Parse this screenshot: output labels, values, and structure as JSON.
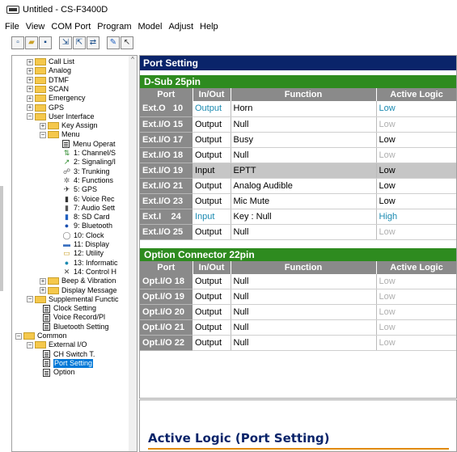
{
  "window": {
    "title": "Untitled - CS-F3400D"
  },
  "menu": [
    "File",
    "View",
    "COM Port",
    "Program",
    "Model",
    "Adjust",
    "Help"
  ],
  "toolbar": [
    "new-icon",
    "open-icon",
    "save-icon",
    "read-radio-icon",
    "write-radio-icon",
    "clone-icon",
    "pen-icon",
    "cursor-icon"
  ],
  "tree": {
    "items": [
      {
        "label": "Call List",
        "level": 1,
        "type": "folder",
        "toggle": "+"
      },
      {
        "label": "Analog",
        "level": 1,
        "type": "folder",
        "toggle": "+"
      },
      {
        "label": "DTMF",
        "level": 1,
        "type": "folder",
        "toggle": "+"
      },
      {
        "label": "SCAN",
        "level": 1,
        "type": "folder",
        "toggle": "+"
      },
      {
        "label": "Emergency",
        "level": 1,
        "type": "folder",
        "toggle": "+"
      },
      {
        "label": "GPS",
        "level": 1,
        "type": "folder",
        "toggle": "+"
      },
      {
        "label": "User Interface",
        "level": 1,
        "type": "folder",
        "toggle": "−"
      },
      {
        "label": "Key Assign",
        "level": 2,
        "type": "folder",
        "toggle": "+"
      },
      {
        "label": "Menu",
        "level": 2,
        "type": "folder",
        "toggle": "−"
      },
      {
        "label": "Menu Operat",
        "level": 3,
        "type": "page"
      },
      {
        "label": "1: Channel/S",
        "level": 3,
        "type": "icon",
        "glyph": "⇅",
        "color": "#2a8a2a"
      },
      {
        "label": "2: Signaling/I",
        "level": 3,
        "type": "icon",
        "glyph": "↗",
        "color": "#2a8a2a"
      },
      {
        "label": "3: Trunking",
        "level": 3,
        "type": "icon",
        "glyph": "☍",
        "color": "#555"
      },
      {
        "label": "4: Functions",
        "level": 3,
        "type": "icon",
        "glyph": "✲",
        "color": "#666"
      },
      {
        "label": "5: GPS",
        "level": 3,
        "type": "icon",
        "glyph": "✈",
        "color": "#333"
      },
      {
        "label": "6: Voice Rec",
        "level": 3,
        "type": "icon",
        "glyph": "▮",
        "color": "#333"
      },
      {
        "label": "7: Audio Sett",
        "level": 3,
        "type": "icon",
        "glyph": "▮",
        "color": "#555"
      },
      {
        "label": "8: SD Card",
        "level": 3,
        "type": "icon",
        "glyph": "▮",
        "color": "#2060c0"
      },
      {
        "label": "9: Bluetooth",
        "level": 3,
        "type": "icon",
        "glyph": "●",
        "color": "#1a4fb0"
      },
      {
        "label": "10: Clock",
        "level": 3,
        "type": "icon",
        "glyph": "◯",
        "color": "#777"
      },
      {
        "label": "11: Display",
        "level": 3,
        "type": "icon",
        "glyph": "▬",
        "color": "#3a70c0"
      },
      {
        "label": "12: Utility",
        "level": 3,
        "type": "icon",
        "glyph": "▭",
        "color": "#c9a02a"
      },
      {
        "label": "13: Informatic",
        "level": 3,
        "type": "icon",
        "glyph": "●",
        "color": "#1a8ab1"
      },
      {
        "label": "14: Control H",
        "level": 3,
        "type": "icon",
        "glyph": "✕",
        "color": "#444"
      },
      {
        "label": "Beep & Vibration",
        "level": 2,
        "type": "folder",
        "toggle": "+"
      },
      {
        "label": "Display Message",
        "level": 2,
        "type": "folder",
        "toggle": "+"
      },
      {
        "label": "Supplemental Functic",
        "level": 1,
        "type": "folder",
        "toggle": "−"
      },
      {
        "label": "Clock Setting",
        "level": 2,
        "type": "page"
      },
      {
        "label": "Voice Record/Pl",
        "level": 2,
        "type": "page"
      },
      {
        "label": "Bluetooth Setting",
        "level": 2,
        "type": "page"
      },
      {
        "label": "Common",
        "level": 0,
        "type": "folder",
        "toggle": "−"
      },
      {
        "label": "External I/O",
        "level": 1,
        "type": "folder",
        "toggle": "−"
      },
      {
        "label": "CH Switch T.",
        "level": 2,
        "type": "page"
      },
      {
        "label": "Port Setting",
        "level": 2,
        "type": "page",
        "selected": true
      },
      {
        "label": "Option",
        "level": 2,
        "type": "page"
      }
    ]
  },
  "panel": {
    "title": "Port Setting",
    "dsub": {
      "header": "D-Sub 25pin",
      "columns": [
        "Port",
        "In/Out",
        "Function",
        "Active Logic"
      ],
      "rows": [
        {
          "port": "Ext.O   10",
          "io": "Output",
          "fn": "Horn",
          "logic": "Low",
          "io_style": "teal",
          "logic_style": "teal"
        },
        {
          "port": "Ext.I/O 15",
          "io": "Output",
          "fn": "Null",
          "logic": "Low",
          "io_style": "",
          "logic_style": "gray"
        },
        {
          "port": "Ext.I/O 17",
          "io": "Output",
          "fn": "Busy",
          "logic": "Low",
          "io_style": "",
          "logic_style": ""
        },
        {
          "port": "Ext.I/O 18",
          "io": "Output",
          "fn": "Null",
          "logic": "Low",
          "io_style": "",
          "logic_style": "gray"
        },
        {
          "port": "Ext.I/O 19",
          "io": "Input",
          "fn": "EPTT",
          "logic": "Low",
          "io_style": "",
          "logic_style": "",
          "selected": true
        },
        {
          "port": "Ext.I/O 21",
          "io": "Output",
          "fn": "Analog Audible",
          "logic": "Low",
          "io_style": "",
          "logic_style": ""
        },
        {
          "port": "Ext.I/O 23",
          "io": "Output",
          "fn": "Mic Mute",
          "logic": "Low",
          "io_style": "",
          "logic_style": ""
        },
        {
          "port": "Ext.I    24",
          "io": "Input",
          "fn": "Key : Null",
          "logic": "High",
          "io_style": "teal",
          "logic_style": "teal"
        },
        {
          "port": "Ext.I/O 25",
          "io": "Output",
          "fn": "Null",
          "logic": "Low",
          "io_style": "",
          "logic_style": "gray"
        }
      ]
    },
    "option": {
      "header": "Option Connector 22pin",
      "columns": [
        "Port",
        "In/Out",
        "Function",
        "Active Logic"
      ],
      "rows": [
        {
          "port": "Opt.I/O 18",
          "io": "Output",
          "fn": "Null",
          "logic": "Low",
          "io_style": "",
          "logic_style": "gray"
        },
        {
          "port": "Opt.I/O 19",
          "io": "Output",
          "fn": "Null",
          "logic": "Low",
          "io_style": "",
          "logic_style": "gray"
        },
        {
          "port": "Opt.I/O 20",
          "io": "Output",
          "fn": "Null",
          "logic": "Low",
          "io_style": "",
          "logic_style": "gray"
        },
        {
          "port": "Opt.I/O 21",
          "io": "Output",
          "fn": "Null",
          "logic": "Low",
          "io_style": "",
          "logic_style": "gray"
        },
        {
          "port": "Opt.I/O 22",
          "io": "Output",
          "fn": "Null",
          "logic": "Low",
          "io_style": "",
          "logic_style": "gray"
        }
      ]
    }
  },
  "help": {
    "title": "Active Logic (Port Setting)"
  },
  "colors": {
    "panel_title_bg": "#0a246a",
    "section_bg": "#2e8b1f",
    "port_cell_bg": "#8a8a8a",
    "accent": "#e28a00"
  }
}
